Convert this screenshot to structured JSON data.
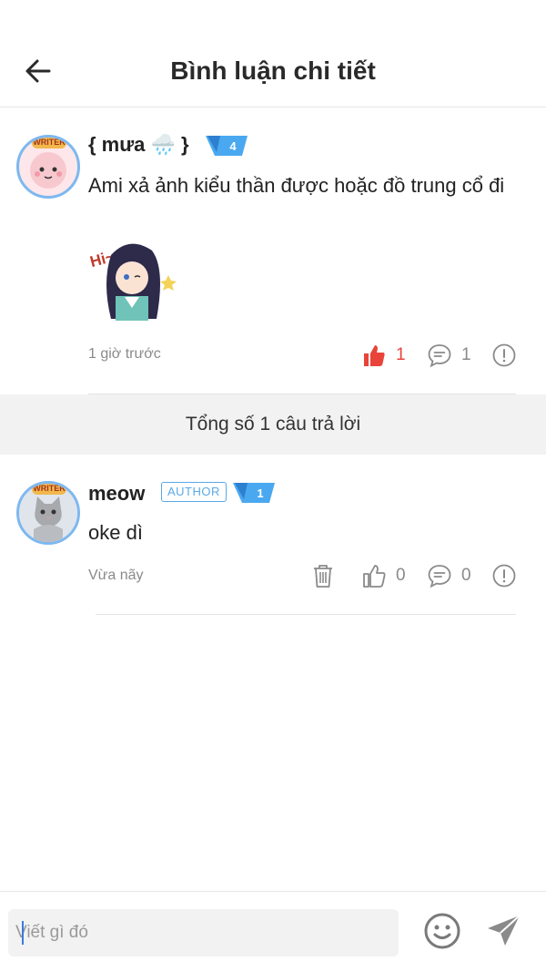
{
  "header": {
    "title": "Bình luận chi tiết",
    "back_icon": "arrow-left-icon"
  },
  "main_comment": {
    "author": "{ mưa 🌧️ }",
    "level": "4",
    "text": "Ami xả ảnh kiểu thần được hoặc đồ trung cổ đi",
    "sticker_caption": "Hi~",
    "time": "1 giờ trước",
    "likes": "1",
    "replies": "1",
    "liked": true
  },
  "total_replies": "Tổng số 1 câu trả lời",
  "reply": {
    "author": "meow",
    "author_badge": "AUTHOR",
    "level": "1",
    "text": "oke dì",
    "time": "Vừa nãy",
    "likes": "0",
    "replies": "0"
  },
  "composer": {
    "placeholder": "Viết gì đó",
    "emoji_icon": "smiley-icon",
    "send_icon": "send-icon"
  },
  "colors": {
    "accent": "#3a7be0",
    "like_active": "#e8443a",
    "badge_blue": "#5aa9e6",
    "muted": "#8a8a8a"
  }
}
